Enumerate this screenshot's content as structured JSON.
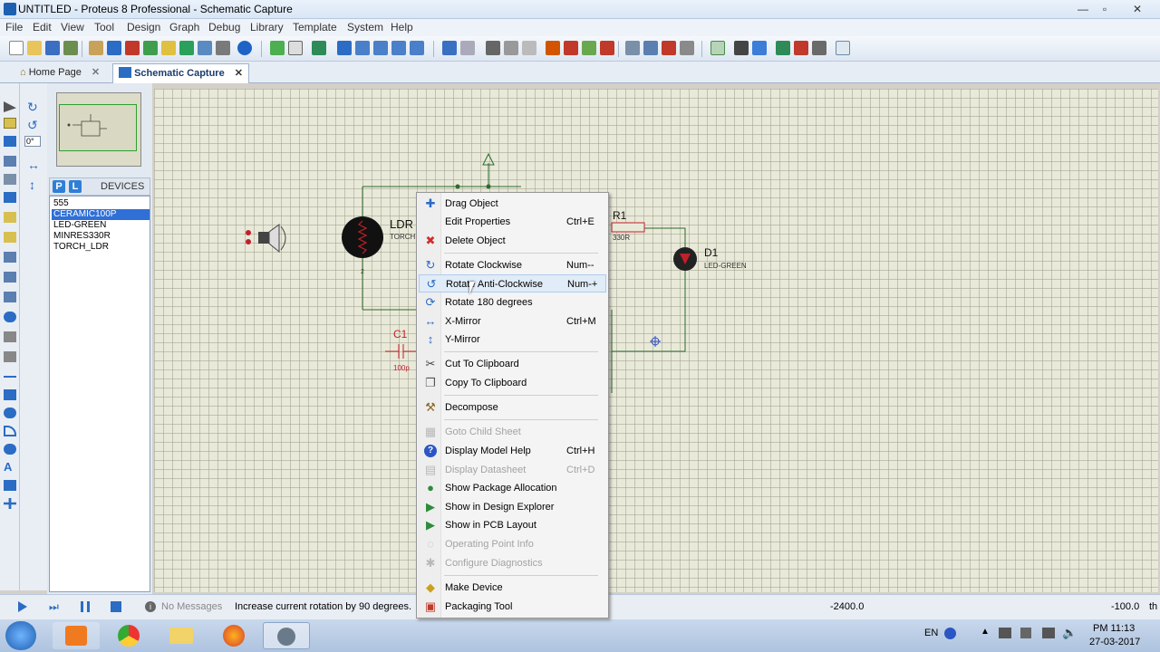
{
  "window": {
    "title": "UNTITLED - Proteus 8 Professional - Schematic Capture",
    "controls": [
      "—",
      "▫",
      "✕"
    ]
  },
  "menubar": [
    "File",
    "Edit",
    "View",
    "Tool",
    "Design",
    "Graph",
    "Debug",
    "Library",
    "Template",
    "System",
    "Help"
  ],
  "tabs": [
    {
      "label": "Home Page",
      "close": "✕"
    },
    {
      "label": "Schematic Capture",
      "close": "✕"
    }
  ],
  "rotation": {
    "value": "0°"
  },
  "devices": {
    "header": "DEVICES",
    "p_btn": "P",
    "l_btn": "L",
    "items": [
      "555",
      "CERAMIC100P",
      "LED-GREEN",
      "MINRES330R",
      "TORCH_LDR"
    ]
  },
  "schematic": {
    "ldr_label": "LDR",
    "ldr_sub": "TORCH",
    "r1_label": "R1",
    "r1_value": "330R",
    "d1_label": "D1",
    "d1_value": "LED-GREEN",
    "c1_label": "C1",
    "c1_value": "100p",
    "pin_2": "2"
  },
  "context_menu": {
    "items": [
      {
        "icon": "✚",
        "label": "Drag Object",
        "shortcut": ""
      },
      {
        "icon": "",
        "label": "Edit Properties",
        "shortcut": "Ctrl+E"
      },
      {
        "icon": "✖",
        "label": "Delete Object",
        "shortcut": ""
      },
      {
        "icon": "↻",
        "label": "Rotate Clockwise",
        "shortcut": "Num--"
      },
      {
        "icon": "↺",
        "label": "Rotate Anti-Clockwise",
        "shortcut": "Num-+"
      },
      {
        "icon": "⟳",
        "label": "Rotate 180 degrees",
        "shortcut": ""
      },
      {
        "icon": "↔",
        "label": "X-Mirror",
        "shortcut": "Ctrl+M"
      },
      {
        "icon": "↕",
        "label": "Y-Mirror",
        "shortcut": ""
      },
      {
        "icon": "✂",
        "label": "Cut To Clipboard",
        "shortcut": ""
      },
      {
        "icon": "❐",
        "label": "Copy To Clipboard",
        "shortcut": ""
      },
      {
        "icon": "⚒",
        "label": "Decompose",
        "shortcut": ""
      },
      {
        "icon": "▦",
        "label": "Goto Child Sheet",
        "shortcut": ""
      },
      {
        "icon": "?",
        "label": "Display Model Help",
        "shortcut": "Ctrl+H"
      },
      {
        "icon": "▤",
        "label": "Display Datasheet",
        "shortcut": "Ctrl+D"
      },
      {
        "icon": "●",
        "label": "Show Package Allocation",
        "shortcut": ""
      },
      {
        "icon": "▶",
        "label": "Show in Design Explorer",
        "shortcut": ""
      },
      {
        "icon": "▶",
        "label": "Show in PCB Layout",
        "shortcut": ""
      },
      {
        "icon": "◌",
        "label": "Operating Point Info",
        "shortcut": ""
      },
      {
        "icon": "✱",
        "label": "Configure Diagnostics",
        "shortcut": ""
      },
      {
        "icon": "◆",
        "label": "Make Device",
        "shortcut": ""
      },
      {
        "icon": "▣",
        "label": "Packaging Tool",
        "shortcut": ""
      }
    ]
  },
  "statusbar": {
    "messages": "No Messages",
    "hint": "Increase current rotation by 90 degrees.",
    "coord_x": "-2400.0",
    "coord_y": "-100.0",
    "unit": "th"
  },
  "taskbar": {
    "lang": "EN",
    "time": "PM 11:13",
    "date": "27-03-2017"
  },
  "colors": {
    "accent": "#2f6fd6",
    "canvas": "#e9e9d9",
    "wire": "#2c6b2c",
    "component": "#c0202a"
  }
}
